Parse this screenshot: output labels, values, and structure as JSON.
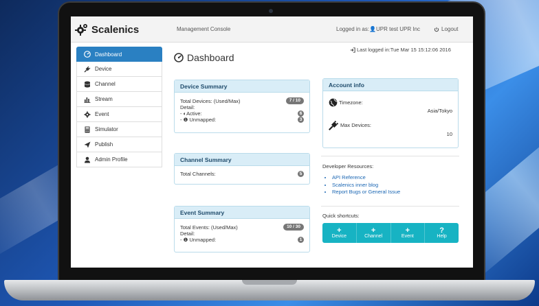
{
  "app": {
    "brand": "Scalenics",
    "nav_console": "Management Console",
    "logged_in": "Logged in as:👤UPR test UPR Inc",
    "logout": "Logout"
  },
  "sidebar": {
    "items": [
      {
        "label": "Dashboard",
        "icon": "dashboard-icon",
        "active": true
      },
      {
        "label": "Device",
        "icon": "plug-icon"
      },
      {
        "label": "Channel",
        "icon": "database-icon"
      },
      {
        "label": "Stream",
        "icon": "bar-chart-icon"
      },
      {
        "label": "Event",
        "icon": "gear-icon"
      },
      {
        "label": "Simulator",
        "icon": "calculator-icon"
      },
      {
        "label": "Publish",
        "icon": "send-icon"
      },
      {
        "label": "Admin Profile",
        "icon": "user-icon"
      }
    ]
  },
  "page": {
    "title": "Dashboard",
    "last_login": "Last logged in:Tue Mar 15 15:12:06 2016"
  },
  "device_summary": {
    "title": "Device Summary",
    "total_label": "Total Devices: (Used/Max)",
    "total_badge": "7 / 10",
    "detail_label": "Detail:",
    "active_label": "- ◐Active:",
    "active_count": "6",
    "unmapped_label": "- ❶ Unmapped:",
    "unmapped_count": "3"
  },
  "channel_summary": {
    "title": "Channel Summary",
    "total_label": "Total Channels:",
    "total_count": "5"
  },
  "event_summary": {
    "title": "Event Summary",
    "total_label": "Total Events: (Used/Max)",
    "total_badge": "10 / 30",
    "detail_label": "Detail:",
    "unmapped_label": "- ❶ Unmapped:",
    "unmapped_count": "1"
  },
  "account_info": {
    "title": "Account info",
    "timezone_label": "Timezone:",
    "timezone_value": "Asia/Tokyo",
    "max_devices_label": "Max Devices:",
    "max_devices_value": "10"
  },
  "developer_resources": {
    "title": "Developer Resources:",
    "links": [
      "API Reference",
      "Scalenics inner blog",
      "Report Bugs or General Issue"
    ]
  },
  "quick_shortcuts": {
    "title": "Quick shortcuts:",
    "buttons": [
      {
        "glyph": "+",
        "label": "Device"
      },
      {
        "glyph": "+",
        "label": "Channel"
      },
      {
        "glyph": "+",
        "label": "Event"
      },
      {
        "glyph": "?",
        "label": "Help"
      }
    ]
  },
  "colors": {
    "active_nav": "#2a80c2",
    "panel_head": "#d9edf7",
    "shortcut_bar": "#17b3c3",
    "link": "#1a66b3"
  }
}
